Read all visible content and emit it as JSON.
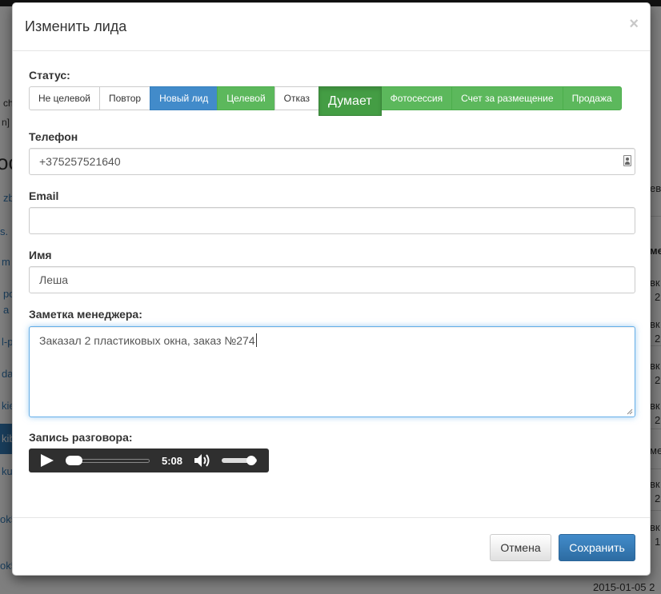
{
  "modal": {
    "title": "Изменить лида",
    "close_label": "×"
  },
  "status": {
    "label": "Статус:",
    "options": [
      {
        "label": "Не целевой",
        "style": "default"
      },
      {
        "label": "Повтор",
        "style": "default"
      },
      {
        "label": "Новый лид",
        "style": "blue"
      },
      {
        "label": "Целевой",
        "style": "green"
      },
      {
        "label": "Отказ",
        "style": "default"
      },
      {
        "label": "Думает",
        "style": "active"
      },
      {
        "label": "Фотосессия",
        "style": "green"
      },
      {
        "label": "Счет за размещение",
        "style": "green"
      },
      {
        "label": "Продажа",
        "style": "green"
      }
    ],
    "selected": "Думает"
  },
  "phone": {
    "label": "Телефон",
    "value": "+375257521640"
  },
  "email": {
    "label": "Email",
    "value": ""
  },
  "name": {
    "label": "Имя",
    "value": "Леша"
  },
  "note": {
    "label": "Заметка менеджера:",
    "value": "Заказал 2 пластиковых окна, заказ №274"
  },
  "recording": {
    "label": "Запись разговора:",
    "duration": "5:08",
    "progress": 0,
    "volume": 0.85
  },
  "footer": {
    "cancel_label": "Отмена",
    "save_label": "Сохранить"
  },
  "background": {
    "side_left": [
      "ch",
      "n]",
      "ос",
      "zb",
      "s.",
      "m",
      "po",
      "a",
      "l-p",
      "da",
      "kie",
      "kib",
      "ku",
      "ok5",
      "ok5"
    ],
    "side_right": [
      "евы",
      "ме",
      "вк",
      "2",
      "вк",
      "2",
      "вк",
      "2",
      "вк",
      "2",
      "ме",
      "вк",
      "2",
      "вк",
      "1"
    ],
    "bottom_date": "2015-01-05 2"
  },
  "colors": {
    "primary": "#428bca",
    "success": "#5cb85c",
    "success_active": "#449d44",
    "player_bg": "#2f2f2f"
  }
}
